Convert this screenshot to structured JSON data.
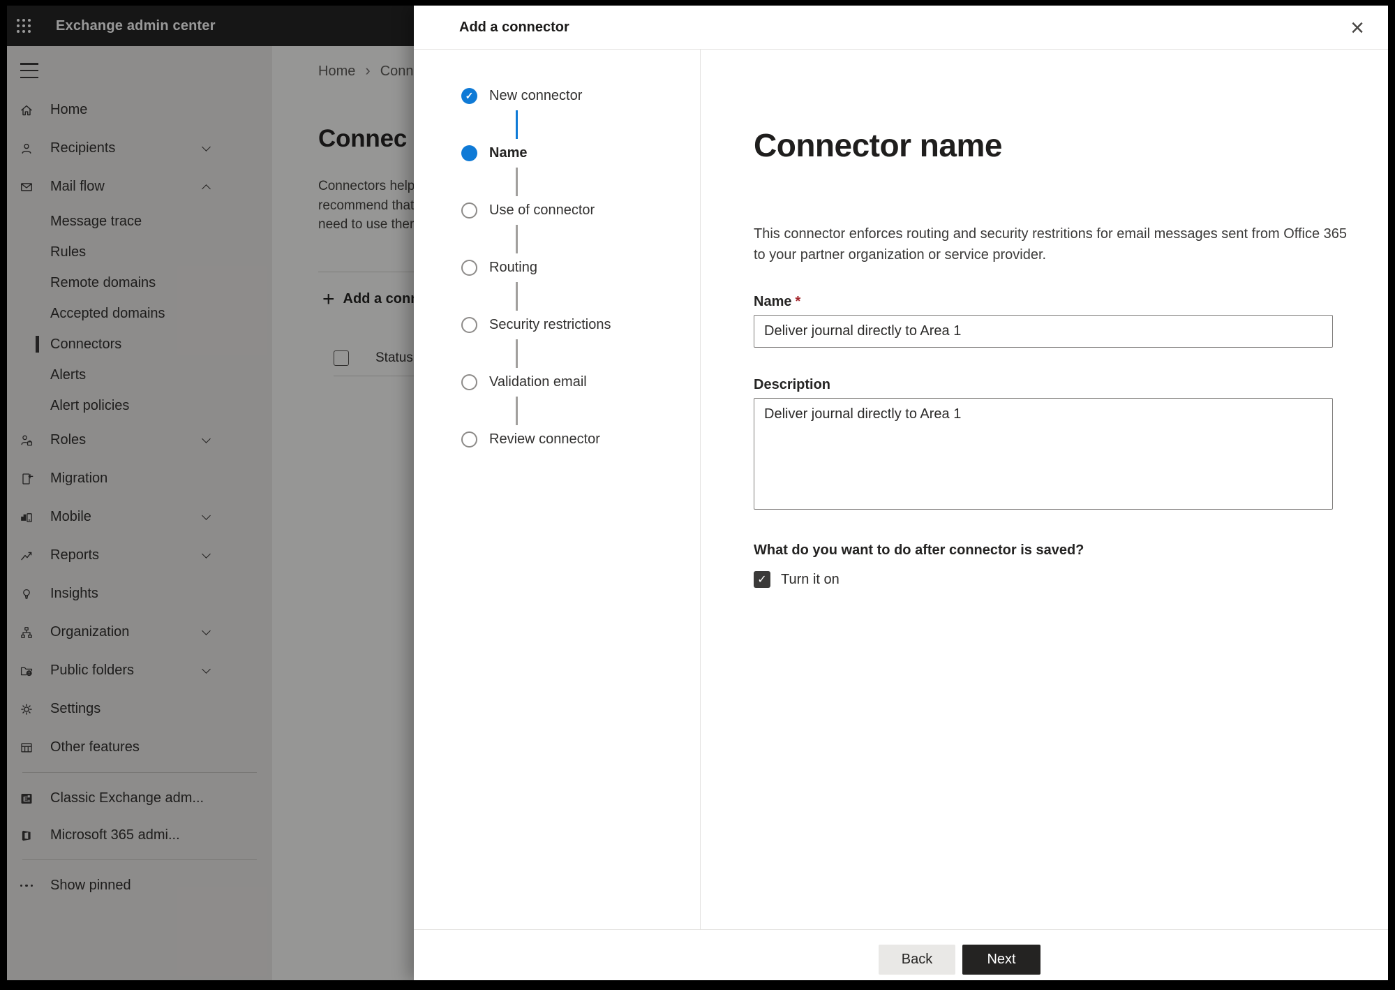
{
  "topbar": {
    "title": "Exchange admin center"
  },
  "sidebar": {
    "items": [
      {
        "label": "Home",
        "icon": "home-icon"
      },
      {
        "label": "Recipients",
        "icon": "recipients-icon",
        "chevron": "down"
      },
      {
        "label": "Mail flow",
        "icon": "mail-flow-icon",
        "chevron": "up",
        "children": [
          "Message trace",
          "Rules",
          "Remote domains",
          "Accepted domains",
          "Connectors",
          "Alerts",
          "Alert policies"
        ],
        "selected_child": "Connectors"
      },
      {
        "label": "Roles",
        "icon": "roles-icon",
        "chevron": "down"
      },
      {
        "label": "Migration",
        "icon": "migration-icon"
      },
      {
        "label": "Mobile",
        "icon": "mobile-icon",
        "chevron": "down"
      },
      {
        "label": "Reports",
        "icon": "reports-icon",
        "chevron": "down"
      },
      {
        "label": "Insights",
        "icon": "insights-icon"
      },
      {
        "label": "Organization",
        "icon": "organization-icon",
        "chevron": "down"
      },
      {
        "label": "Public folders",
        "icon": "public-folders-icon",
        "chevron": "down"
      },
      {
        "label": "Settings",
        "icon": "settings-icon"
      },
      {
        "label": "Other features",
        "icon": "other-features-icon"
      }
    ],
    "footer_items": [
      {
        "label": "Classic Exchange adm...",
        "icon": "classic-exchange-icon"
      },
      {
        "label": "Microsoft 365 admi...",
        "icon": "microsoft-365-icon"
      }
    ],
    "show_pinned": "Show pinned"
  },
  "page": {
    "breadcrumb": {
      "home": "Home",
      "current": "Conne"
    },
    "title": "Connec",
    "paragraph_lines": [
      "Connectors help",
      "recommend that",
      "need to use ther"
    ],
    "add_button_label": "Add a conn",
    "table": {
      "status_header": "Status"
    }
  },
  "dialog": {
    "title": "Add a connector",
    "steps": [
      {
        "label": "New connector",
        "state": "completed"
      },
      {
        "label": "Name",
        "state": "current"
      },
      {
        "label": "Use of connector",
        "state": "upcoming"
      },
      {
        "label": "Routing",
        "state": "upcoming"
      },
      {
        "label": "Security restrictions",
        "state": "upcoming"
      },
      {
        "label": "Validation email",
        "state": "upcoming"
      },
      {
        "label": "Review connector",
        "state": "upcoming"
      }
    ],
    "content": {
      "title": "Connector name",
      "description": "This connector enforces routing and security restritions for email messages sent from Office 365 to your partner organization or service provider.",
      "name_label": "Name",
      "required_mark": "*",
      "name_value": "Deliver journal directly to Area 1",
      "description_label": "Description",
      "description_value": "Deliver journal directly to Area 1",
      "question": "What do you want to do after connector is saved?",
      "checkbox_label": "Turn it on",
      "checkbox_checked": true
    },
    "footer": {
      "back_label": "Back",
      "next_label": "Next"
    }
  },
  "glyphs": {
    "check": "✓",
    "close": "×",
    "plus": "+",
    "crumb_sep": ""
  },
  "colors": {
    "accent_blue": "#0f7ad6",
    "required_red": "#a4262c",
    "dark_button": "#242322",
    "topbar_bg": "#262626"
  }
}
